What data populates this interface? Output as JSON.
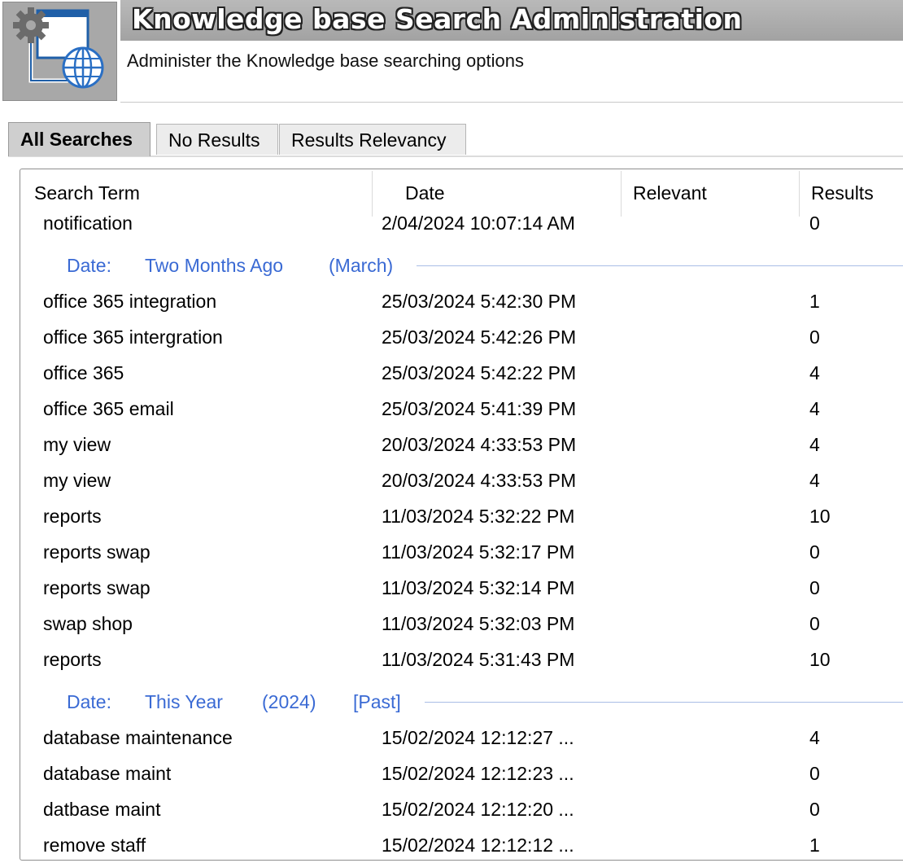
{
  "header": {
    "title": "Knowledge base Search Administration",
    "subtitle": "Administer the Knowledge base searching options",
    "icon": "admin-settings-globe-icon"
  },
  "tabs": [
    {
      "label": "All Searches",
      "active": true
    },
    {
      "label": "No Results",
      "active": false
    },
    {
      "label": "Results Relevancy",
      "active": false
    }
  ],
  "grid": {
    "columns": [
      "Search Term",
      "Date",
      "Relevant",
      "Results"
    ],
    "rows_top": [
      {
        "term": "notification",
        "date": "2/04/2024 10:07:14 AM",
        "relevant": "",
        "results": "0"
      }
    ],
    "groups": [
      {
        "prefix": "Date:",
        "name": "Two Months Ago",
        "detail": "(March)",
        "extra": "",
        "rows": [
          {
            "term": "office 365 integration",
            "date": "25/03/2024 5:42:30 PM",
            "relevant": "",
            "results": "1"
          },
          {
            "term": "office 365 intergration",
            "date": "25/03/2024 5:42:26 PM",
            "relevant": "",
            "results": "0"
          },
          {
            "term": "office 365",
            "date": "25/03/2024 5:42:22 PM",
            "relevant": "",
            "results": "4"
          },
          {
            "term": "office 365 email",
            "date": "25/03/2024 5:41:39 PM",
            "relevant": "",
            "results": "4"
          },
          {
            "term": "my view",
            "date": "20/03/2024 4:33:53 PM",
            "relevant": "",
            "results": "4"
          },
          {
            "term": "my view",
            "date": "20/03/2024 4:33:53 PM",
            "relevant": "",
            "results": "4"
          },
          {
            "term": "reports",
            "date": "11/03/2024 5:32:22 PM",
            "relevant": "",
            "results": "10"
          },
          {
            "term": "reports swap",
            "date": "11/03/2024 5:32:17 PM",
            "relevant": "",
            "results": "0"
          },
          {
            "term": "reports swap",
            "date": "11/03/2024 5:32:14 PM",
            "relevant": "",
            "results": "0"
          },
          {
            "term": "swap shop",
            "date": "11/03/2024 5:32:03 PM",
            "relevant": "",
            "results": "0"
          },
          {
            "term": "reports",
            "date": "11/03/2024 5:31:43 PM",
            "relevant": "",
            "results": "10"
          }
        ]
      },
      {
        "prefix": "Date:",
        "name": "This Year",
        "detail": "(2024)",
        "extra": "[Past]",
        "rows": [
          {
            "term": "database maintenance",
            "date": "15/02/2024 12:12:27 ...",
            "relevant": "",
            "results": "4"
          },
          {
            "term": "database maint",
            "date": "15/02/2024 12:12:23 ...",
            "relevant": "",
            "results": "0"
          },
          {
            "term": "datbase maint",
            "date": "15/02/2024 12:12:20 ...",
            "relevant": "",
            "results": "0"
          },
          {
            "term": "remove staff",
            "date": "15/02/2024 12:12:12 ...",
            "relevant": "",
            "results": "1"
          }
        ]
      }
    ]
  }
}
